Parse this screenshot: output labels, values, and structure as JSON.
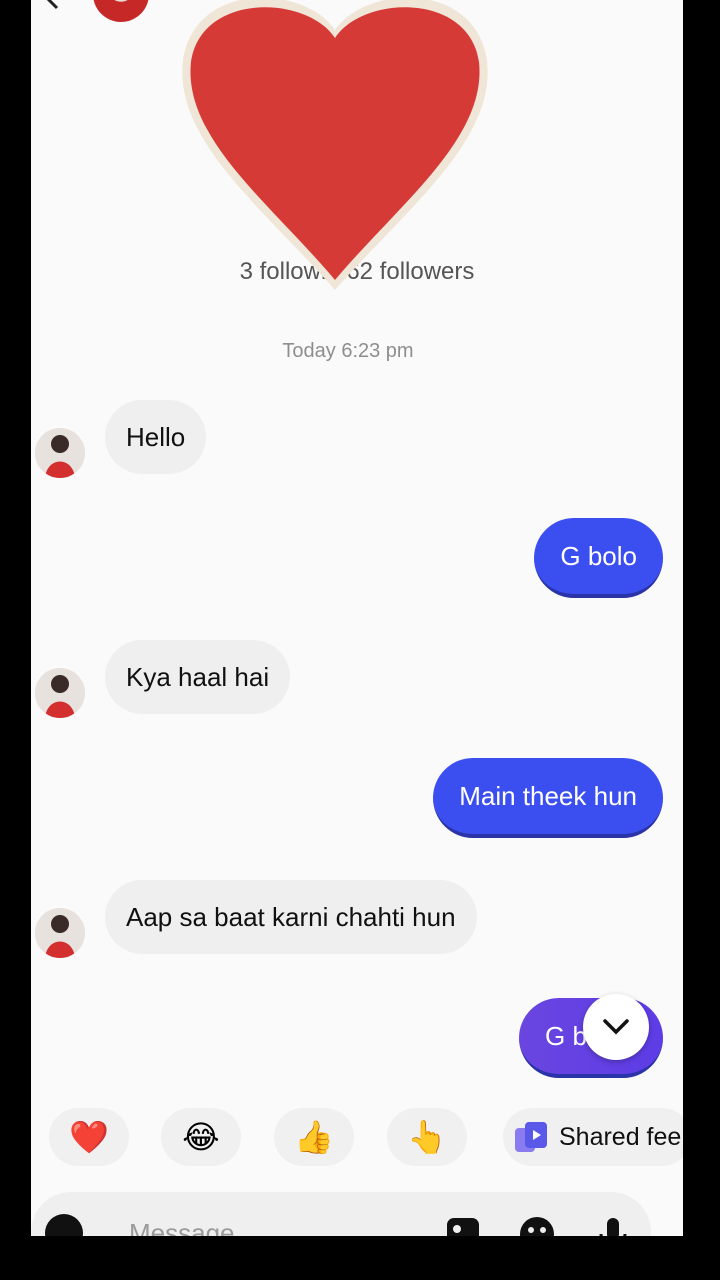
{
  "profile": {
    "followers_text": "3 followi   162 followers"
  },
  "conversation": {
    "timestamp": "Today 6:23 pm",
    "messages": [
      {
        "sender": "them",
        "text": "Hello"
      },
      {
        "sender": "me",
        "text": "G bolo"
      },
      {
        "sender": "them",
        "text": "Kya haal hai"
      },
      {
        "sender": "me",
        "text": "Main theek hun"
      },
      {
        "sender": "them",
        "text": "Aap sa baat karni chahti hun"
      },
      {
        "sender": "me",
        "text": "G b"
      }
    ]
  },
  "reactions": {
    "items": [
      "❤️",
      "😂",
      "👍",
      "👆"
    ],
    "shared_label": "Shared fee"
  },
  "composer": {
    "placeholder": "Message"
  },
  "colors": {
    "outgoing_bubble": "#3b4ff0",
    "incoming_bubble": "#efefef",
    "heart": "#d63a36"
  }
}
